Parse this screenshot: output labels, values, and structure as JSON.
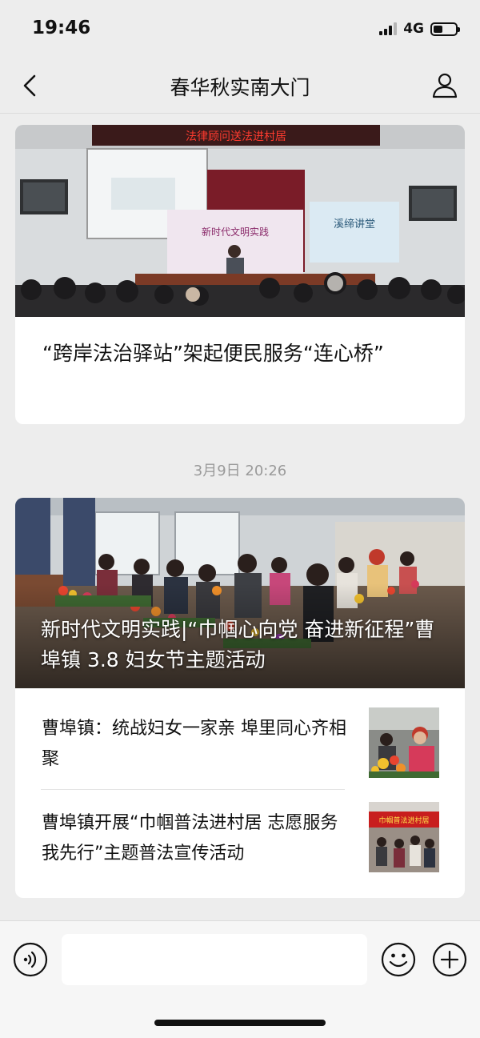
{
  "status_bar": {
    "time": "19:46",
    "network": "4G"
  },
  "nav": {
    "title": "春华秋实南大门"
  },
  "article1": {
    "title": "“跨岸法治驿站”架起便民服务“连心桥”",
    "banner_text": "法律顾问送法进村居",
    "board_text": "新时代文明实践",
    "board_text2": "溪缔讲堂"
  },
  "timestamp": "3月9日 20:26",
  "article2": {
    "cover_title": "新时代文明实践|“巾帼心向党 奋进新征程”曹埠镇 3.8 妇女节主题活动",
    "items": [
      {
        "title": "曹埠镇：统战妇女一家亲  埠里同心齐相聚"
      },
      {
        "title": "曹埠镇开展“巾帼普法进村居 志愿服务我先行”主题普法宣传活动",
        "thumb_banner": "巾帼普法进村居"
      }
    ]
  },
  "input_bar": {
    "placeholder": ""
  },
  "colors": {
    "background": "#ededed",
    "card": "#ffffff",
    "banner_red": "#c81e1e"
  },
  "icons": [
    "back-arrow-icon",
    "profile-icon",
    "voice-icon",
    "emoji-icon",
    "plus-icon"
  ]
}
